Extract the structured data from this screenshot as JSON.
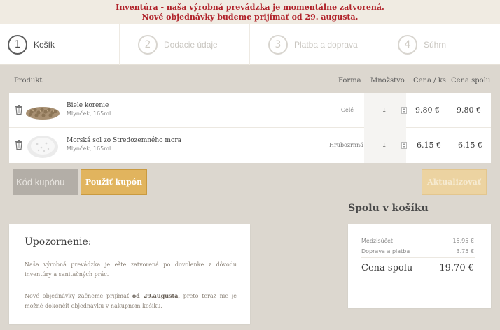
{
  "banner": {
    "line1": "Inventúra - naša výrobná prevádzka je momentálne zatvorená.",
    "line2": "Nové objednávky budeme prijímať od 29. augusta."
  },
  "steps": [
    {
      "num": "1",
      "label": "Košík"
    },
    {
      "num": "2",
      "label": "Dodacie údaje"
    },
    {
      "num": "3",
      "label": "Platba a doprava"
    },
    {
      "num": "4",
      "label": "Súhrn"
    }
  ],
  "table": {
    "headers": {
      "product": "Produkt",
      "form": "Forma",
      "quantity": "Množstvo",
      "unit_price": "Cena / ks",
      "total": "Cena spolu"
    },
    "rows": [
      {
        "name": "Biele korenie",
        "sub": "Mlynček, 165ml",
        "form": "Celé",
        "qty": "1",
        "unit_price": "9.80 €",
        "total": "9.80 €"
      },
      {
        "name": "Morská soľ zo Stredozemného mora",
        "sub": "Mlynček, 165ml",
        "form": "Hrubozrnná",
        "qty": "1",
        "unit_price": "6.15 €",
        "total": "6.15 €"
      }
    ]
  },
  "coupon": {
    "placeholder": "Kód kupónu",
    "apply_label": "Použiť kupón"
  },
  "update_label": "Aktualizovať",
  "notice": {
    "title": "Upozornenie:",
    "p1": "Naša výrobná prevádzka je ešte zatvorená po dovolenke z dôvodu inventúry a sanitačných prác.",
    "p2_pre": "Nové objednávky začneme prijímať ",
    "p2_bold": "od 29.augusta",
    "p2_post": ", preto teraz nie je možné dokončiť objednávku v nákupnom košíku."
  },
  "totals": {
    "title": "Spolu v košíku",
    "subtotal_label": "Medzisúčet",
    "subtotal": "15.95 €",
    "shipping_label": "Doprava a platba",
    "shipping": "3.75 €",
    "total_label": "Cena spolu",
    "total": "19.70 €"
  },
  "colors": {
    "banner_text": "#b0222a",
    "accent_button": "#e1b45e",
    "background": "#dcd7cf"
  }
}
